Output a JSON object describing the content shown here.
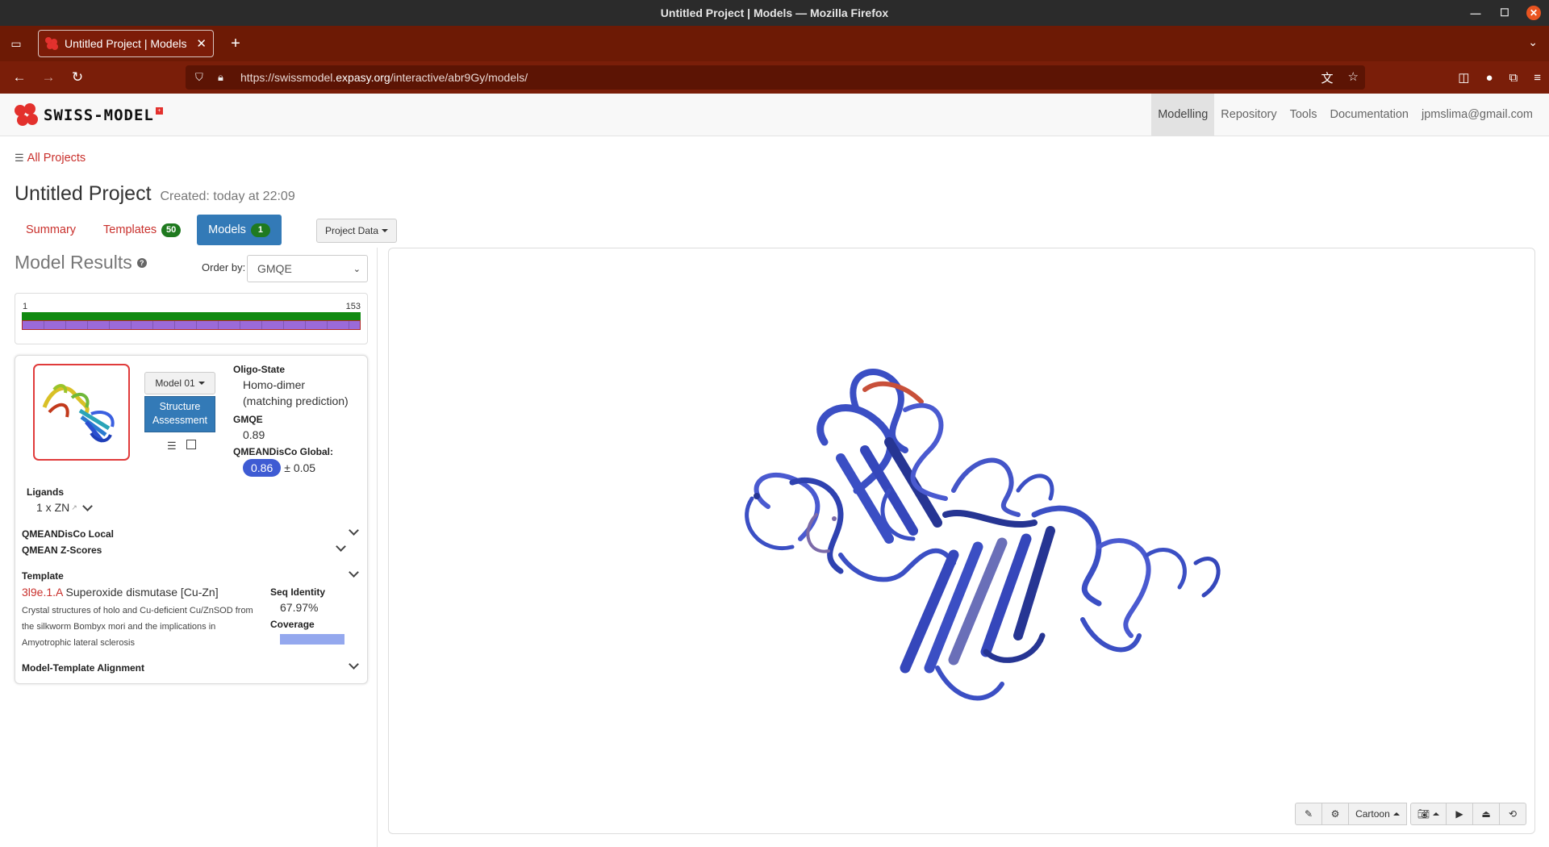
{
  "os": {
    "window_title": "Untitled Project | Models — Mozilla Firefox"
  },
  "browser": {
    "tab_title": "Untitled Project | Models",
    "url_prefix": "https://swissmodel.",
    "url_host": "expasy.org",
    "url_path": "/interactive/abr9Gy/models/"
  },
  "site": {
    "logo_text": "SWISS-MODEL",
    "nav": [
      "Modelling",
      "Repository",
      "Tools",
      "Documentation",
      "jpmslima@gmail.com"
    ]
  },
  "page": {
    "breadcrumb": "All Projects",
    "project_title": "Untitled Project",
    "created": "Created: today at 22:09",
    "tabs": {
      "summary": "Summary",
      "templates": "Templates",
      "templates_count": "50",
      "models": "Models",
      "models_count": "1"
    },
    "project_data_label": "Project Data",
    "results_title": "Model Results",
    "order_label": "Order by:",
    "order_value": "GMQE",
    "coverage": {
      "start": "1",
      "end": "153"
    }
  },
  "model": {
    "selector": "Model 01",
    "assessment_button": "Structure Assessment",
    "oligo_label": "Oligo-State",
    "oligo_value": "Homo-dimer",
    "oligo_note": "(matching prediction)",
    "gmqe_label": "GMQE",
    "gmqe_value": "0.89",
    "qmean_global_label": "QMEANDisCo Global:",
    "qmean_global_value": "0.86",
    "qmean_global_err": "± 0.05",
    "ligands_label": "Ligands",
    "ligands_value": "1 x ZN",
    "qmean_local_label": "QMEANDisCo Local",
    "qmean_z_label": "QMEAN Z-Scores",
    "template_label": "Template",
    "template_id": "3l9e.1.A",
    "template_name": "Superoxide dismutase [Cu-Zn]",
    "template_desc": "Crystal structures of holo and Cu-deficient Cu/ZnSOD from the silkworm Bombyx mori and the implications in Amyotrophic lateral sclerosis",
    "seq_identity_label": "Seq Identity",
    "seq_identity_value": "67.97%",
    "coverage_label": "Coverage",
    "alignment_label": "Model-Template Alignment"
  },
  "viewer": {
    "render_mode": "Cartoon",
    "colors": {
      "ribbon": "#3b4fc4",
      "ribbon_dark": "#263593",
      "accent": "#c8503a"
    }
  }
}
